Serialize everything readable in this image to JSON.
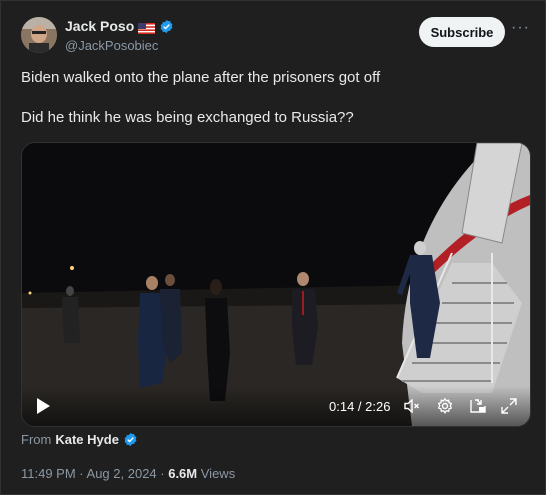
{
  "author": {
    "display_name": "Jack Poso",
    "handle": "@JackPosobiec"
  },
  "header": {
    "subscribe_label": "Subscribe",
    "more_label": "···"
  },
  "tweet": {
    "line1": "Biden walked onto the plane after the prisoners got off",
    "line2": "Did he think he was being exchanged to Russia??"
  },
  "video": {
    "current_time": "0:14",
    "duration": "2:26",
    "time_separator": " / "
  },
  "source": {
    "prefix": "From",
    "name": "Kate Hyde"
  },
  "meta": {
    "time": "11:49 PM",
    "date": "Aug 2, 2024",
    "separator": " · ",
    "views": "6.6M",
    "views_label": "Views"
  },
  "colors": {
    "verified": "#1d9bf0",
    "background": "#1f1f1f",
    "subscribe_bg": "#eff3f4"
  }
}
